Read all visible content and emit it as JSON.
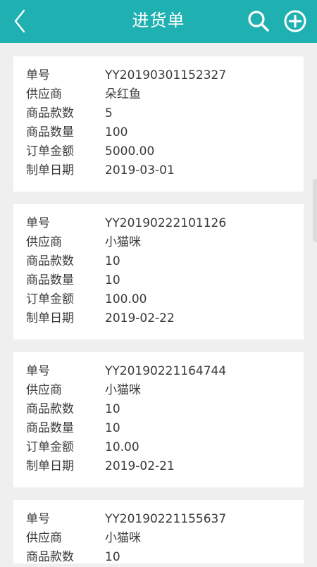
{
  "header": {
    "title": "进货单"
  },
  "orders": [
    {
      "rows": [
        {
          "label": "单号",
          "value": "YY20190301152327"
        },
        {
          "label": "供应商",
          "value": "朵红鱼"
        },
        {
          "label": "商品款数",
          "value": "5"
        },
        {
          "label": "商品数量",
          "value": "100"
        },
        {
          "label": "订单金额",
          "value": "5000.00"
        },
        {
          "label": "制单日期",
          "value": "2019-03-01"
        }
      ]
    },
    {
      "rows": [
        {
          "label": "单号",
          "value": "YY20190222101126"
        },
        {
          "label": "供应商",
          "value": "小猫咪"
        },
        {
          "label": "商品款数",
          "value": "10"
        },
        {
          "label": "商品数量",
          "value": "10"
        },
        {
          "label": "订单金额",
          "value": "100.00"
        },
        {
          "label": "制单日期",
          "value": "2019-02-22"
        }
      ]
    },
    {
      "rows": [
        {
          "label": "单号",
          "value": "YY20190221164744"
        },
        {
          "label": "供应商",
          "value": "小猫咪"
        },
        {
          "label": "商品款数",
          "value": "10"
        },
        {
          "label": "商品数量",
          "value": "10"
        },
        {
          "label": "订单金额",
          "value": "10.00"
        },
        {
          "label": "制单日期",
          "value": "2019-02-21"
        }
      ]
    },
    {
      "rows": [
        {
          "label": "单号",
          "value": "YY20190221155637"
        },
        {
          "label": "供应商",
          "value": "小猫咪"
        },
        {
          "label": "商品款数",
          "value": "10"
        }
      ]
    }
  ]
}
